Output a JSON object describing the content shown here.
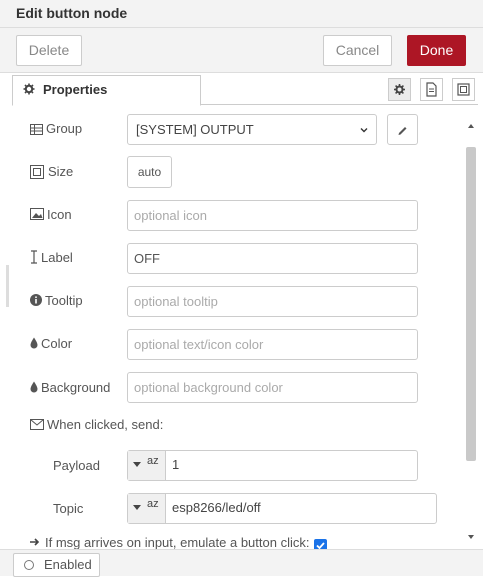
{
  "dialog": {
    "title": "Edit button node",
    "delete_label": "Delete",
    "cancel_label": "Cancel",
    "done_label": "Done",
    "accent_color": "#ad1625"
  },
  "tabs": {
    "properties_label": "Properties"
  },
  "form": {
    "group_label": "Group",
    "group_value": "[SYSTEM] OUTPUT",
    "size_label": "Size",
    "size_value": "auto",
    "icon_label": "Icon",
    "icon_placeholder": "optional icon",
    "label_label": "Label",
    "label_value": "OFF",
    "tooltip_label": "Tooltip",
    "tooltip_placeholder": "optional tooltip",
    "color_label": "Color",
    "color_placeholder": "optional text/icon color",
    "background_label": "Background",
    "background_placeholder": "optional background color",
    "when_clicked_label": "When clicked, send:",
    "payload_label": "Payload",
    "payload_type": "az",
    "payload_value": "1",
    "topic_label": "Topic",
    "topic_type": "az",
    "topic_value": "esp8266/led/off",
    "emulate_label": "If msg arrives on input, emulate a button click:",
    "emulate_checked": true
  },
  "footer": {
    "enabled_label": "Enabled"
  },
  "icons": [
    "gear-icon",
    "description-icon",
    "appearance-icon",
    "table-icon",
    "size-icon",
    "image-icon",
    "text-cursor-icon",
    "info-icon",
    "droplet-icon",
    "envelope-icon",
    "pencil-icon",
    "chevron-down-icon",
    "caret-down-icon",
    "arrow-icon",
    "checkbox-icon"
  ]
}
